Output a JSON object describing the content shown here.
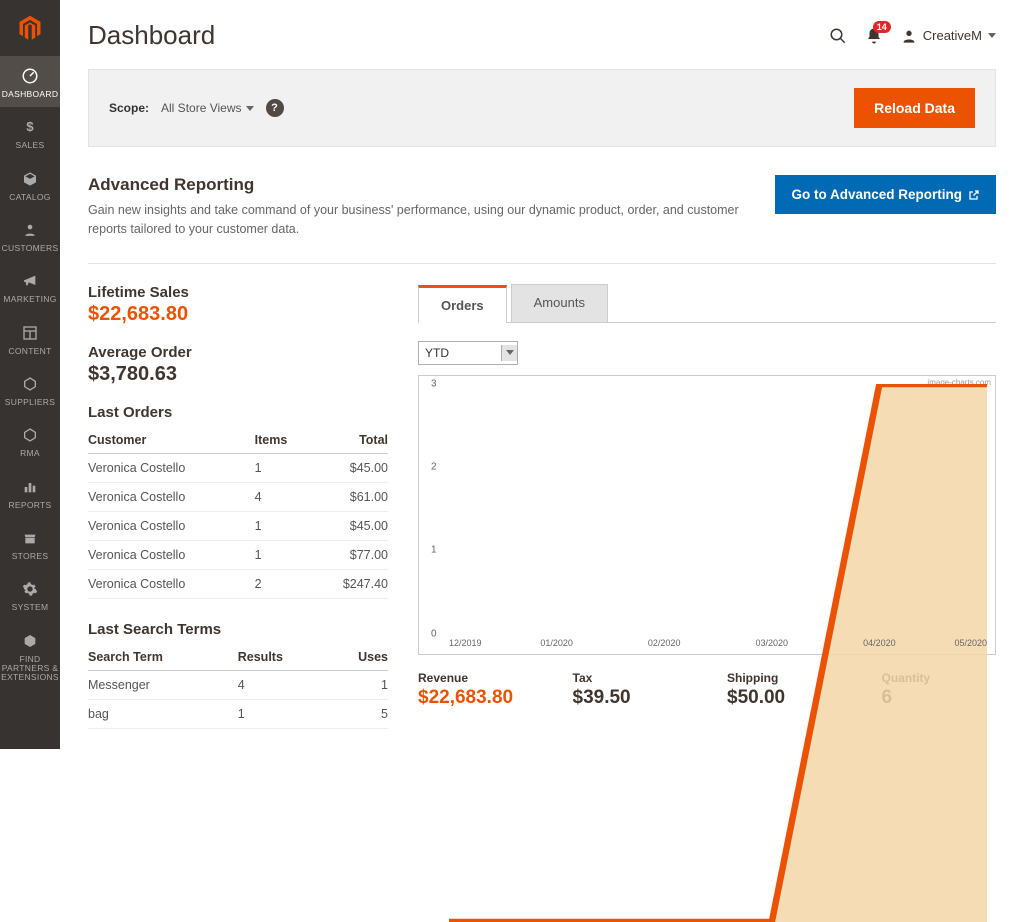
{
  "page_title": "Dashboard",
  "notifications_count": "14",
  "user_name": "CreativeM",
  "sidebar": [
    {
      "key": "dashboard",
      "label": "DASHBOARD"
    },
    {
      "key": "sales",
      "label": "SALES"
    },
    {
      "key": "catalog",
      "label": "CATALOG"
    },
    {
      "key": "customers",
      "label": "CUSTOMERS"
    },
    {
      "key": "marketing",
      "label": "MARKETING"
    },
    {
      "key": "content",
      "label": "CONTENT"
    },
    {
      "key": "suppliers",
      "label": "SUPPLIERS"
    },
    {
      "key": "rma",
      "label": "RMA"
    },
    {
      "key": "reports",
      "label": "REPORTS"
    },
    {
      "key": "stores",
      "label": "STORES"
    },
    {
      "key": "system",
      "label": "SYSTEM"
    },
    {
      "key": "partners",
      "label": "FIND\nPARTNERS &\nEXTENSIONS"
    }
  ],
  "scope": {
    "label": "Scope:",
    "value": "All Store Views"
  },
  "reload_btn": "Reload Data",
  "adv_reporting": {
    "title": "Advanced Reporting",
    "desc": "Gain new insights and take command of your business' performance, using our dynamic product, order, and customer reports tailored to your customer data.",
    "cta": "Go to Advanced Reporting"
  },
  "stats": {
    "lifetime_sales_label": "Lifetime Sales",
    "lifetime_sales_value": "$22,683.80",
    "avg_order_label": "Average Order",
    "avg_order_value": "$3,780.63"
  },
  "last_orders": {
    "title": "Last Orders",
    "cols": {
      "customer": "Customer",
      "items": "Items",
      "total": "Total"
    },
    "rows": [
      {
        "customer": "Veronica Costello",
        "items": "1",
        "total": "$45.00"
      },
      {
        "customer": "Veronica Costello",
        "items": "4",
        "total": "$61.00"
      },
      {
        "customer": "Veronica Costello",
        "items": "1",
        "total": "$45.00"
      },
      {
        "customer": "Veronica Costello",
        "items": "1",
        "total": "$77.00"
      },
      {
        "customer": "Veronica Costello",
        "items": "2",
        "total": "$247.40"
      }
    ]
  },
  "last_search": {
    "title": "Last Search Terms",
    "cols": {
      "term": "Search Term",
      "results": "Results",
      "uses": "Uses"
    },
    "rows": [
      {
        "term": "Messenger",
        "results": "4",
        "uses": "1"
      },
      {
        "term": "bag",
        "results": "1",
        "uses": "5"
      }
    ]
  },
  "tabs": {
    "orders": "Orders",
    "amounts": "Amounts"
  },
  "period_selected": "YTD",
  "chart_credit": "image-charts.com",
  "bottom_stats": {
    "revenue_label": "Revenue",
    "revenue_val": "$22,683.80",
    "tax_label": "Tax",
    "tax_val": "$39.50",
    "shipping_label": "Shipping",
    "shipping_val": "$50.00",
    "qty_label": "Quantity",
    "qty_val": "6"
  },
  "chart_data": {
    "type": "area",
    "title": "",
    "xlabel": "",
    "ylabel": "",
    "ylim": [
      0,
      3
    ],
    "categories": [
      "12/2019",
      "01/2020",
      "02/2020",
      "03/2020",
      "04/2020",
      "05/2020"
    ],
    "values": [
      0,
      0,
      0,
      0,
      3,
      3
    ]
  },
  "colors": {
    "accent": "#eb5202",
    "link": "#006bb4",
    "danger": "#e22626"
  }
}
